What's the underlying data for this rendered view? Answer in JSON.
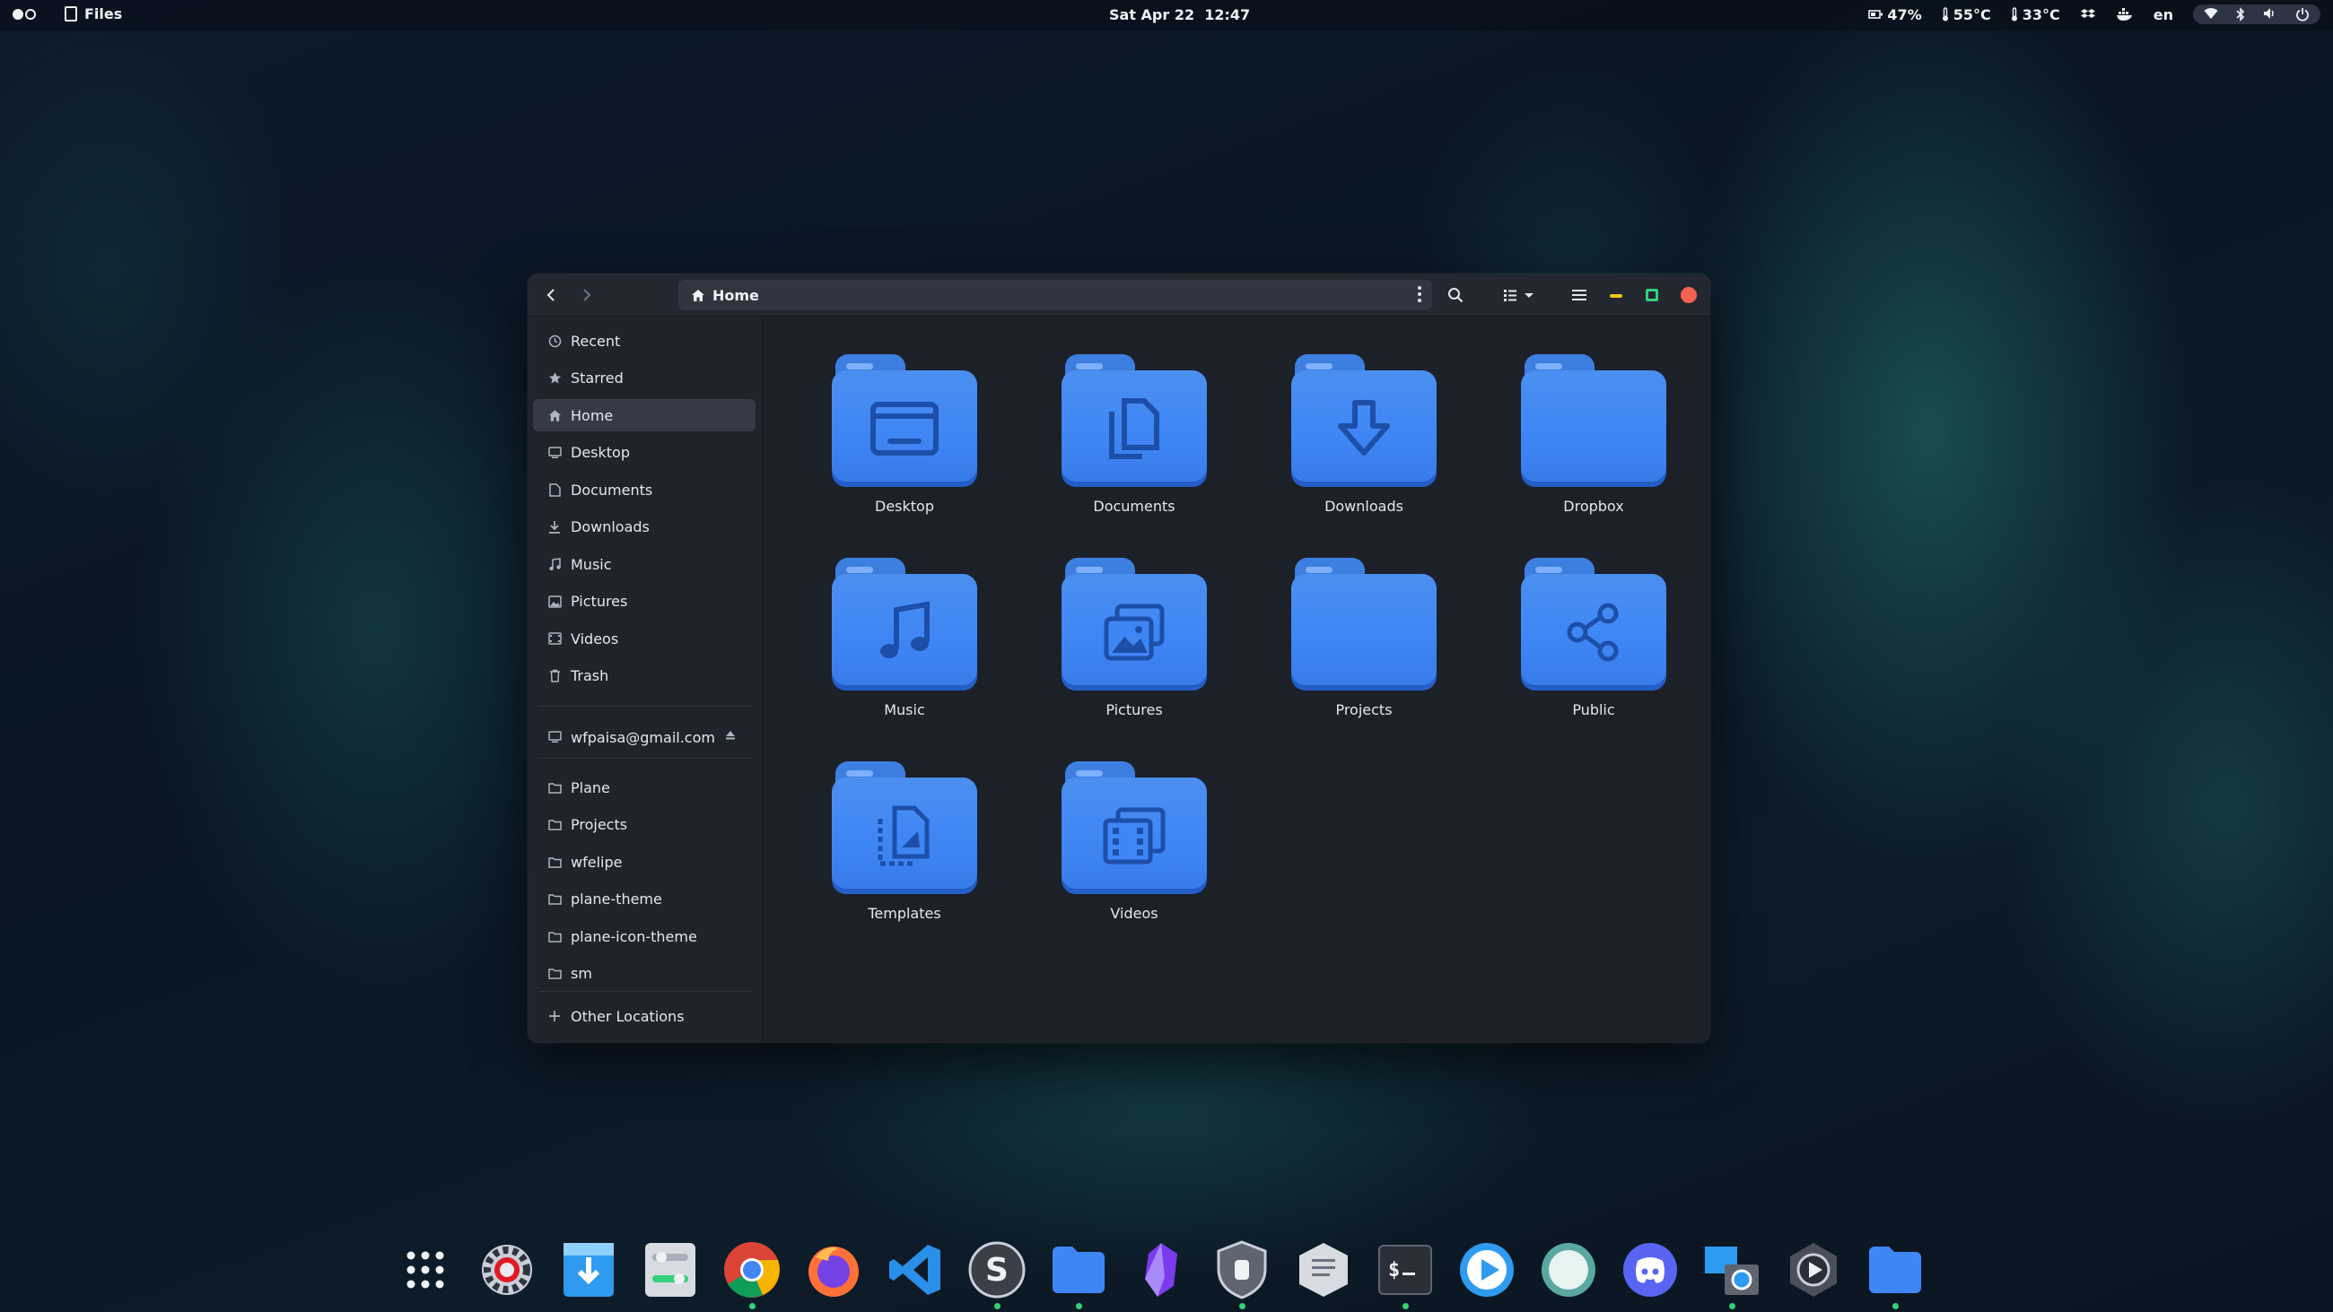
{
  "topbar": {
    "app_name": "Files",
    "clock": "Sat Apr 22  12:47",
    "battery": "47%",
    "temp_cpu": "55°C",
    "temp_gpu": "33°C",
    "keyboard_layout": "en"
  },
  "window": {
    "path": "Home",
    "controls": {
      "minimize": "#f5c211",
      "maximize": "#33d17a",
      "close": "#f66151"
    }
  },
  "sidebar": {
    "places": [
      {
        "label": "Recent",
        "icon": "clock-icon"
      },
      {
        "label": "Starred",
        "icon": "star-icon"
      },
      {
        "label": "Home",
        "icon": "home-icon",
        "active": true
      },
      {
        "label": "Desktop",
        "icon": "desktop-icon"
      },
      {
        "label": "Documents",
        "icon": "document-icon"
      },
      {
        "label": "Downloads",
        "icon": "download-icon"
      },
      {
        "label": "Music",
        "icon": "music-icon"
      },
      {
        "label": "Pictures",
        "icon": "picture-icon"
      },
      {
        "label": "Videos",
        "icon": "video-icon"
      },
      {
        "label": "Trash",
        "icon": "trash-icon"
      }
    ],
    "account": "wfpaisa@gmail.com",
    "bookmarks": [
      "Plane",
      "Projects",
      "wfelipe",
      "plane-theme",
      "plane-icon-theme",
      "sm"
    ],
    "other_locations": "Other Locations"
  },
  "folders": [
    {
      "label": "Desktop",
      "icon": "desktop-folder-icon"
    },
    {
      "label": "Documents",
      "icon": "documents-folder-icon"
    },
    {
      "label": "Downloads",
      "icon": "downloads-folder-icon"
    },
    {
      "label": "Dropbox",
      "icon": "folder-icon"
    },
    {
      "label": "Music",
      "icon": "music-folder-icon"
    },
    {
      "label": "Pictures",
      "icon": "pictures-folder-icon"
    },
    {
      "label": "Projects",
      "icon": "folder-icon"
    },
    {
      "label": "Public",
      "icon": "public-folder-icon"
    },
    {
      "label": "Templates",
      "icon": "templates-folder-icon"
    },
    {
      "label": "Videos",
      "icon": "videos-folder-icon"
    }
  ],
  "dock": [
    {
      "icon": "app-grid-icon"
    },
    {
      "icon": "settings-icon"
    },
    {
      "icon": "software-installer-icon"
    },
    {
      "icon": "tweaks-icon"
    },
    {
      "icon": "chrome-icon",
      "running": true
    },
    {
      "icon": "firefox-icon"
    },
    {
      "icon": "vscode-icon"
    },
    {
      "icon": "sublime-icon",
      "running": true
    },
    {
      "icon": "files-icon",
      "running": true
    },
    {
      "icon": "obsidian-icon"
    },
    {
      "icon": "vpn-shield-icon",
      "running": true
    },
    {
      "icon": "text-editor-icon"
    },
    {
      "icon": "terminal-icon",
      "running": true
    },
    {
      "icon": "media-player-icon"
    },
    {
      "icon": "disk-usage-icon"
    },
    {
      "icon": "discord-icon"
    },
    {
      "icon": "screenshot-icon",
      "running": true
    },
    {
      "icon": "video-player-icon"
    },
    {
      "icon": "folder-app-icon",
      "running": true
    }
  ]
}
